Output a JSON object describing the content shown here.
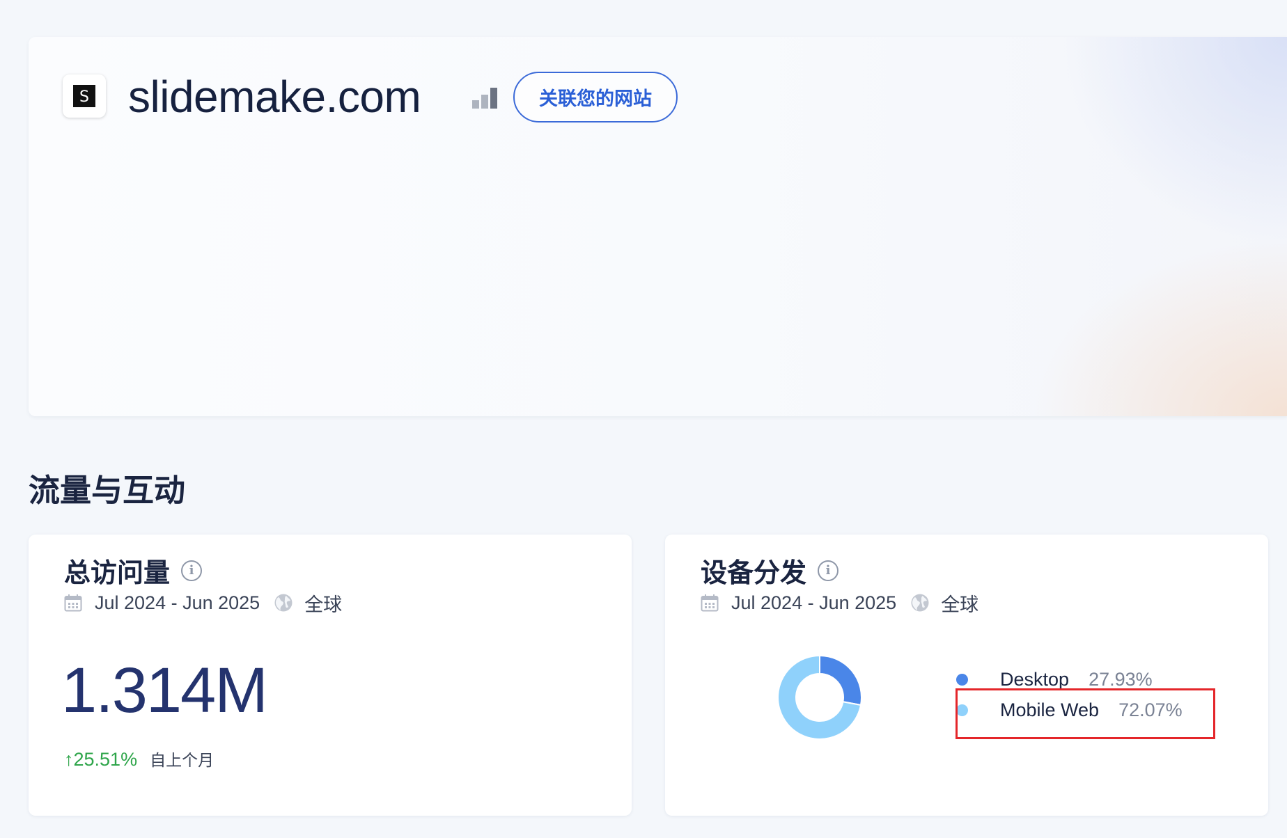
{
  "header": {
    "site_icon_letter": "S",
    "site_name": "slidemake.com",
    "connect_button": "关联您的网站"
  },
  "section": {
    "title": "流量与互动"
  },
  "visits_card": {
    "title": "总访问量",
    "date_range": "Jul 2024 - Jun 2025",
    "region": "全球",
    "total": "1.314M",
    "change": "↑25.51%",
    "change_label": "自上个月"
  },
  "device_card": {
    "title": "设备分发",
    "date_range": "Jul 2024 - Jun 2025",
    "region": "全球",
    "legend": [
      {
        "label": "Desktop",
        "value": "27.93%",
        "color": "#4a86e8"
      },
      {
        "label": "Mobile Web",
        "value": "72.07%",
        "color": "#8fd1fb"
      }
    ]
  },
  "chart_data": {
    "type": "pie",
    "categories": [
      "Desktop",
      "Mobile Web"
    ],
    "values": [
      27.93,
      72.07
    ],
    "colors": [
      "#4a86e8",
      "#8fd1fb"
    ],
    "donut": true
  },
  "colors": {
    "accent": "#2a5fd6",
    "positive": "#2ea54a",
    "highlight_box": "#e4262a"
  }
}
